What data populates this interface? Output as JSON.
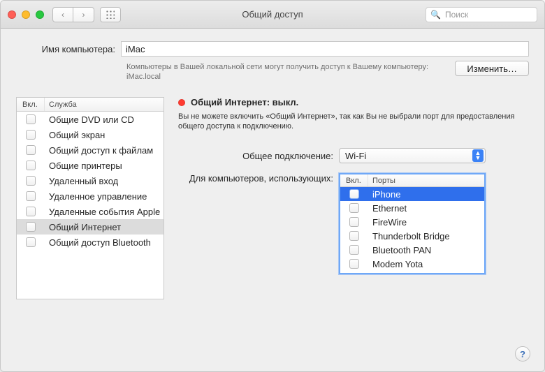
{
  "window": {
    "title": "Общий доступ"
  },
  "search": {
    "placeholder": "Поиск"
  },
  "computer_name": {
    "label": "Имя компьютера:",
    "value": "iMac",
    "hint": "Компьютеры в Вашей локальной сети могут получить доступ к Вашему компьютеру: iMac.local",
    "edit_button": "Изменить…"
  },
  "services": {
    "header_on": "Вкл.",
    "header_name": "Служба",
    "items": [
      {
        "label": "Общие DVD или CD",
        "selected": false
      },
      {
        "label": "Общий экран",
        "selected": false
      },
      {
        "label": "Общий доступ к файлам",
        "selected": false
      },
      {
        "label": "Общие принтеры",
        "selected": false
      },
      {
        "label": "Удаленный вход",
        "selected": false
      },
      {
        "label": "Удаленное управление",
        "selected": false
      },
      {
        "label": "Удаленные события Apple",
        "selected": false
      },
      {
        "label": "Общий Интернет",
        "selected": true
      },
      {
        "label": "Общий доступ Bluetooth",
        "selected": false
      }
    ]
  },
  "detail": {
    "status_label": "Общий Интернет: выкл.",
    "status_color": "#ff3b30",
    "description": "Вы не можете включить «Общий Интернет», так как Вы не выбрали порт для предоставления общего доступа к подключению.",
    "share_from_label": "Общее подключение:",
    "share_from_value": "Wi-Fi",
    "to_computers_label": "Для компьютеров, использующих:",
    "ports_header_on": "Вкл.",
    "ports_header_name": "Порты",
    "ports": [
      {
        "label": "iPhone",
        "selected": true
      },
      {
        "label": "Ethernet",
        "selected": false
      },
      {
        "label": "FireWire",
        "selected": false
      },
      {
        "label": "Thunderbolt Bridge",
        "selected": false
      },
      {
        "label": "Bluetooth PAN",
        "selected": false
      },
      {
        "label": "Modem Yota",
        "selected": false
      }
    ]
  },
  "help": "?"
}
